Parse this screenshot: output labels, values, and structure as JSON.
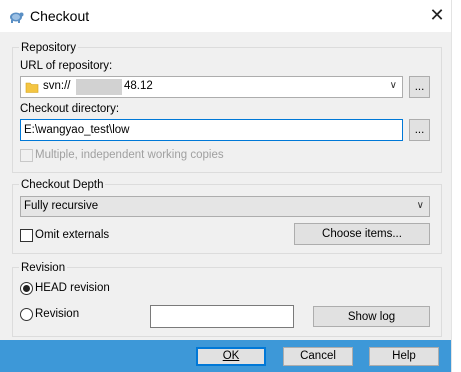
{
  "window": {
    "title": "Checkout",
    "close_glyph": "✕"
  },
  "repository": {
    "group_label": "Repository",
    "url_label": "URL of repository:",
    "url_prefix": "svn://",
    "url_suffix": "48.12",
    "browse_label": "...",
    "dir_label": "Checkout directory:",
    "dir_value": "E:\\wangyao_test\\low",
    "dir_browse_label": "...",
    "multiple_label": "Multiple, independent working copies"
  },
  "depth": {
    "group_label": "Checkout Depth",
    "selected": "Fully recursive",
    "omit_label": "Omit externals",
    "choose_label": "Choose items..."
  },
  "revision": {
    "group_label": "Revision",
    "head_label": "HEAD revision",
    "revision_label": "Revision",
    "revision_value": "",
    "showlog_label": "Show log"
  },
  "footer": {
    "ok_label": "OK",
    "cancel_label": "Cancel",
    "help_label": "Help"
  },
  "colors": {
    "accent": "#0078d7",
    "footer": "#3d98d8",
    "folder": "#f4c542"
  }
}
